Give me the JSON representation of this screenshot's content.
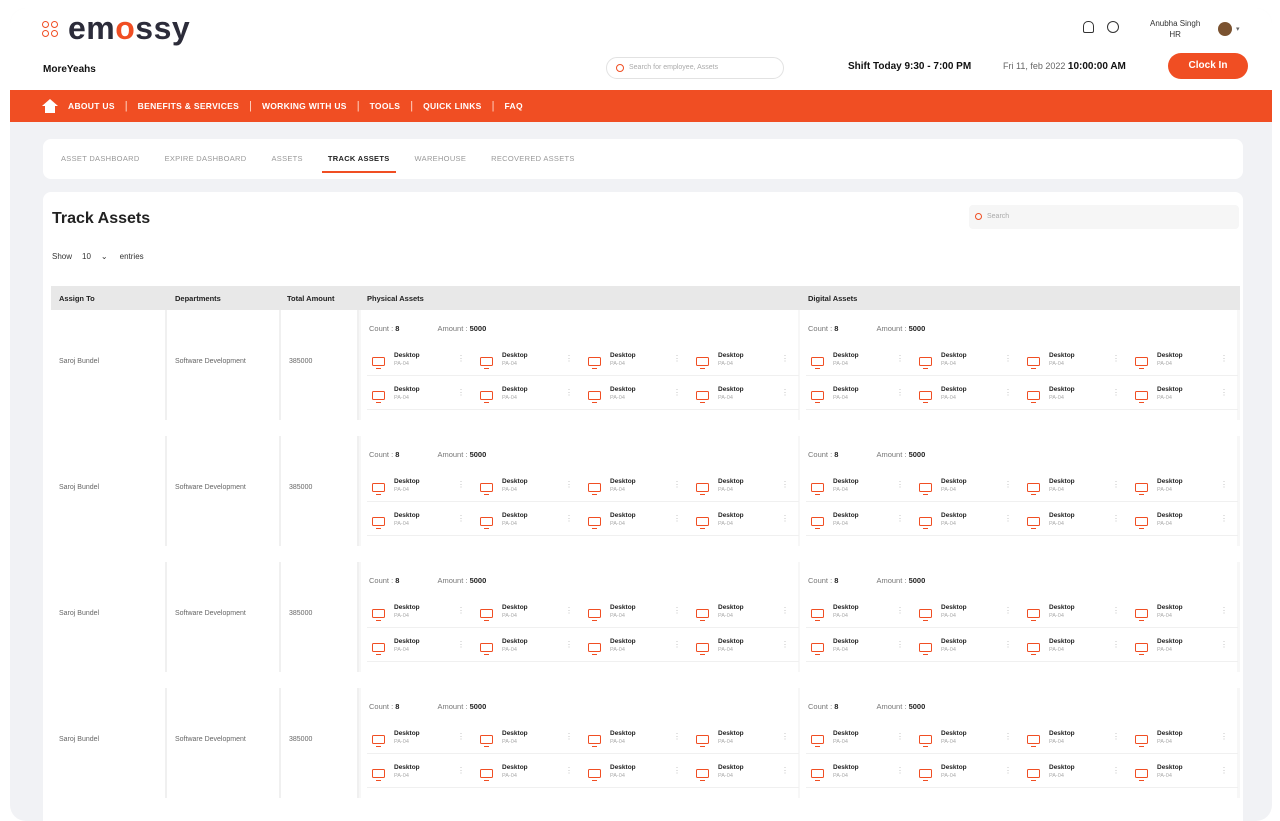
{
  "app": {
    "logo_text_pre": "em",
    "logo_text_o": "o",
    "logo_text_post": "ssy",
    "company": "MoreYeahs",
    "search_placeholder": "Search for employee, Assets",
    "shift": "Shift Today 9:30 - 7:00 PM",
    "date": "Fri 11, feb 2022",
    "time": "10:00:00 AM",
    "clock_in": "Clock In",
    "user_name": "Anubha Singh",
    "user_role": "HR",
    "accent_color": "#f04e23"
  },
  "nav": {
    "items": [
      "ABOUT US",
      "BENEFITS & SERVICES",
      "WORKING WITH US",
      "TOOLS",
      "QUICK LINKS",
      "FAQ"
    ]
  },
  "tabs": [
    "ASSET DASHBOARD",
    "EXPIRE DASHBOARD",
    "ASSETS",
    "TRACK ASSETS",
    "WAREHOUSE",
    "RECOVERED ASSETS"
  ],
  "active_tab": "TRACK ASSETS",
  "panel": {
    "title": "Track Assets",
    "search_placeholder": "Search",
    "show_label": "Show",
    "entries_value": "10",
    "entries_label": "entries"
  },
  "table": {
    "headers": [
      "Assign To",
      "Departments",
      "Total Amount",
      "Physical Assets",
      "Digital Assets"
    ],
    "count_label": "Count :",
    "amount_label": "Amount :",
    "rows": [
      {
        "assign_to": "Saroj Bundel",
        "department": "Software Development",
        "total": "385000",
        "physical_count": "8",
        "physical_amount": "5000",
        "digital_count": "8",
        "digital_amount": "5000"
      },
      {
        "assign_to": "Saroj Bundel",
        "department": "Software Development",
        "total": "385000",
        "physical_count": "8",
        "physical_amount": "5000",
        "digital_count": "8",
        "digital_amount": "5000"
      },
      {
        "assign_to": "Saroj Bundel",
        "department": "Software Development",
        "total": "385000",
        "physical_count": "8",
        "physical_amount": "5000",
        "digital_count": "8",
        "digital_amount": "5000"
      },
      {
        "assign_to": "Saroj Bundel",
        "department": "Software Development",
        "total": "385000",
        "physical_count": "8",
        "physical_amount": "5000",
        "digital_count": "8",
        "digital_amount": "5000"
      }
    ],
    "asset_item": {
      "name": "Desktop",
      "sub": "PA-04"
    }
  }
}
